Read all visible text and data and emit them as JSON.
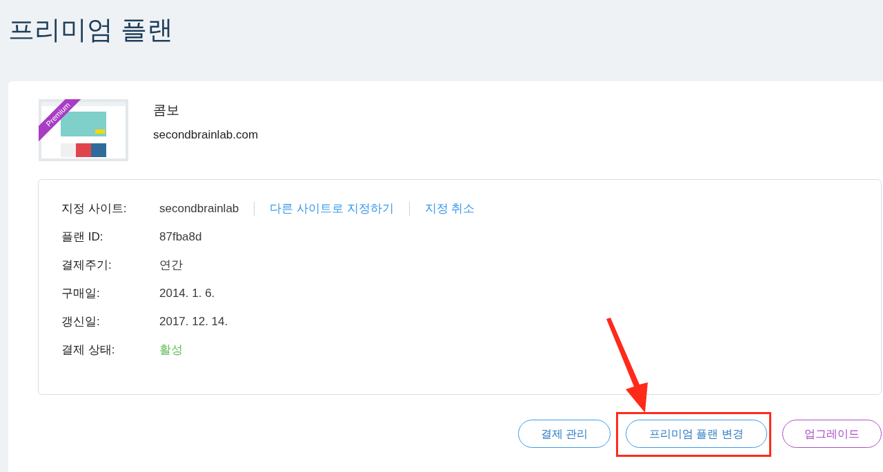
{
  "page_title": "프리미엄 플랜",
  "plan": {
    "thumbnail_ribbon": "Premium",
    "name": "콤보",
    "domain": "secondbrainlab.com"
  },
  "details": [
    {
      "kind": "links",
      "label": "지정 사이트:",
      "value": "secondbrainlab",
      "links": [
        "다른 사이트로 지정하기",
        "지정 취소"
      ]
    },
    {
      "kind": "text",
      "label": "플랜 ID:",
      "value": "87fba8d"
    },
    {
      "kind": "text",
      "label": "결제주기:",
      "value": "연간"
    },
    {
      "kind": "text",
      "label": "구매일:",
      "value": "2014. 1. 6."
    },
    {
      "kind": "text",
      "label": "갱신일:",
      "value": "2017. 12. 14."
    },
    {
      "kind": "status",
      "label": "결제 상태:",
      "value": "활성"
    }
  ],
  "buttons": [
    {
      "kind": "primary",
      "label": "결제 관리",
      "highlighted": false
    },
    {
      "kind": "primary",
      "label": "프리미엄 플랜 변경",
      "highlighted": true
    },
    {
      "kind": "upgrade",
      "label": "업그레이드",
      "highlighted": false
    }
  ]
}
